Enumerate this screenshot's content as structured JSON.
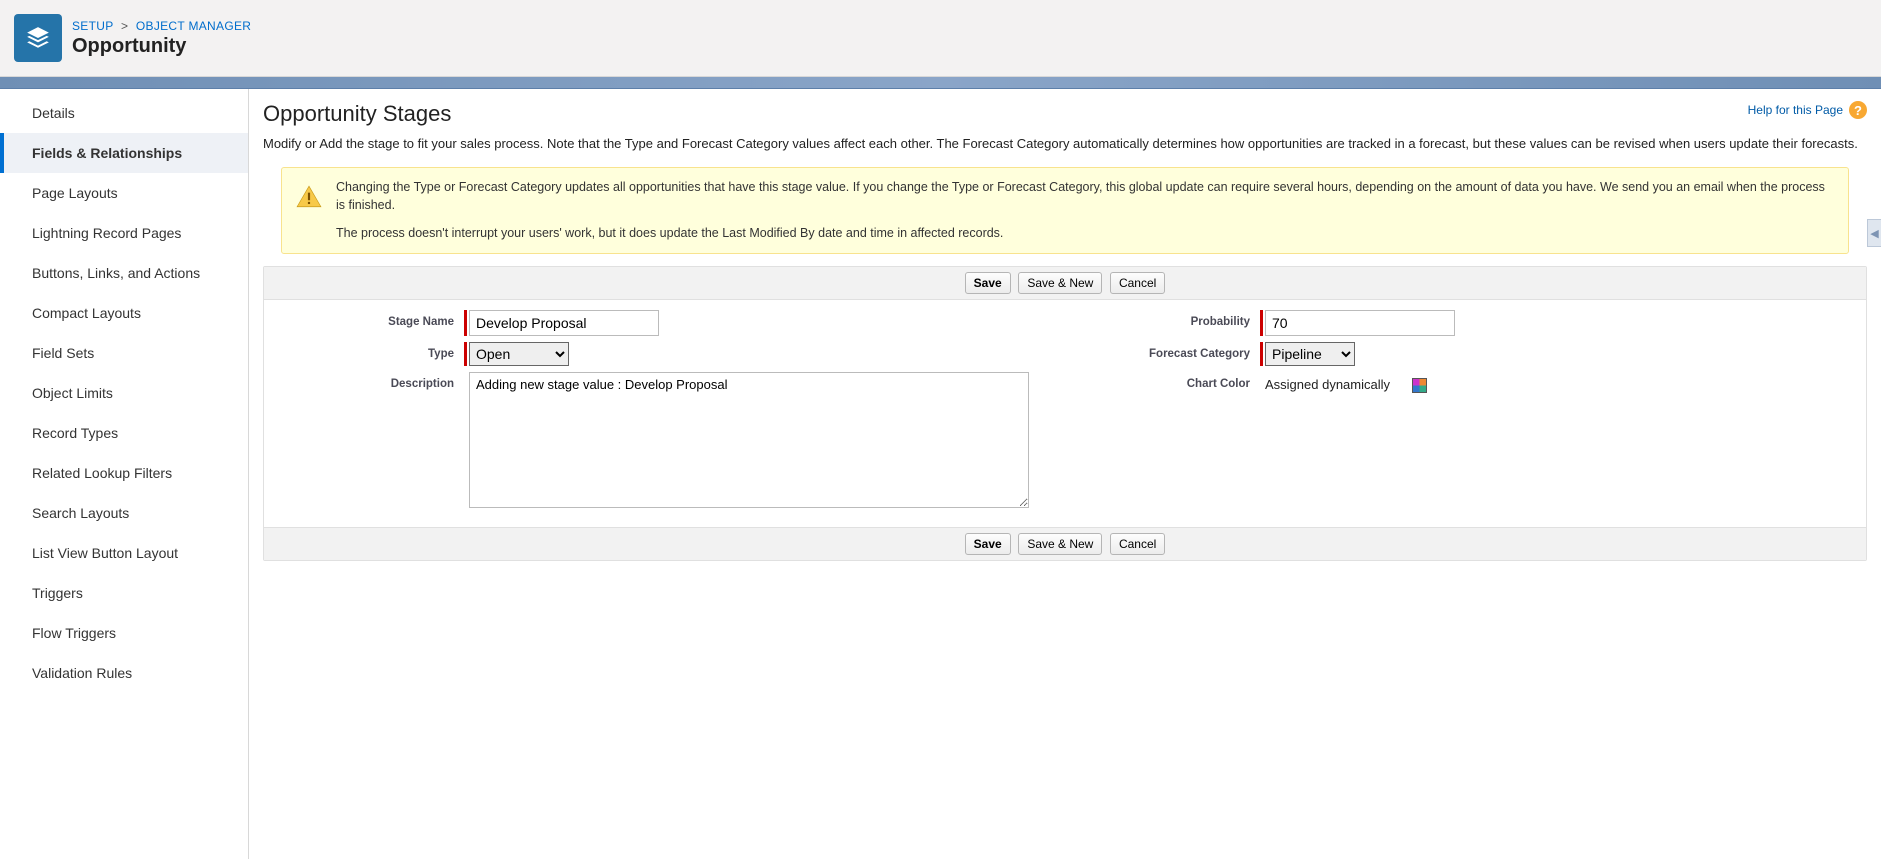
{
  "header": {
    "breadcrumb": {
      "setup": "SETUP",
      "object_manager": "OBJECT MANAGER"
    },
    "title": "Opportunity"
  },
  "sidebar": {
    "items": [
      {
        "label": "Details"
      },
      {
        "label": "Fields & Relationships",
        "active": true
      },
      {
        "label": "Page Layouts"
      },
      {
        "label": "Lightning Record Pages"
      },
      {
        "label": "Buttons, Links, and Actions"
      },
      {
        "label": "Compact Layouts"
      },
      {
        "label": "Field Sets"
      },
      {
        "label": "Object Limits"
      },
      {
        "label": "Record Types"
      },
      {
        "label": "Related Lookup Filters"
      },
      {
        "label": "Search Layouts"
      },
      {
        "label": "List View Button Layout"
      },
      {
        "label": "Triggers"
      },
      {
        "label": "Flow Triggers"
      },
      {
        "label": "Validation Rules"
      }
    ]
  },
  "main": {
    "title": "Opportunity Stages",
    "help_label": "Help for this Page",
    "intro": "Modify or Add the stage to fit your sales process. Note that the Type and Forecast Category values affect each other. The Forecast Category automatically determines how opportunities are tracked in a forecast, but these values can be revised when users update their forecasts.",
    "warning": {
      "p1": "Changing the Type or Forecast Category updates all opportunities that have this stage value. If you change the Type or Forecast Category, this global update can require several hours, depending on the amount of data you have. We send you an email when the process is finished.",
      "p2": "The process doesn't interrupt your users' work, but it does update the Last Modified By date and time in affected records."
    },
    "buttons": {
      "save": "Save",
      "save_new": "Save & New",
      "cancel": "Cancel"
    },
    "labels": {
      "stage_name": "Stage Name",
      "type": "Type",
      "description": "Description",
      "probability": "Probability",
      "forecast_category": "Forecast Category",
      "chart_color": "Chart Color"
    },
    "values": {
      "stage_name": "Develop Proposal",
      "type": "Open",
      "description": "Adding new stage value : Develop Proposal",
      "probability": "70",
      "forecast_category": "Pipeline",
      "chart_color": "Assigned dynamically"
    }
  }
}
